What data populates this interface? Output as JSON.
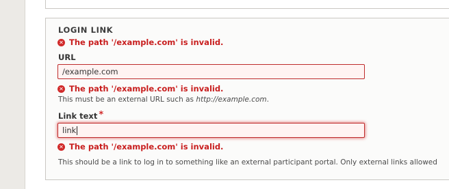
{
  "login_link": {
    "legend": "LOGIN LINK",
    "group_error": "The path '/example.com' is invalid.",
    "url_field": {
      "label": "URL",
      "value": "/example.com",
      "error": "The path '/example.com' is invalid.",
      "description_prefix": "This must be an external URL such as ",
      "description_example": "http://example.com",
      "description_suffix": "."
    },
    "link_text_field": {
      "label": "Link text",
      "required_marker": "*",
      "value": "link",
      "error": "The path '/example.com' is invalid.",
      "description": "This should be a link to log in to something like an external participant portal. Only external links allowed"
    }
  },
  "icons": {
    "error": "error-circle-x-icon"
  },
  "colors": {
    "error_text": "#c81e1e",
    "error_border": "#bd2a2a",
    "error_field_bg": "#fff3f2"
  }
}
